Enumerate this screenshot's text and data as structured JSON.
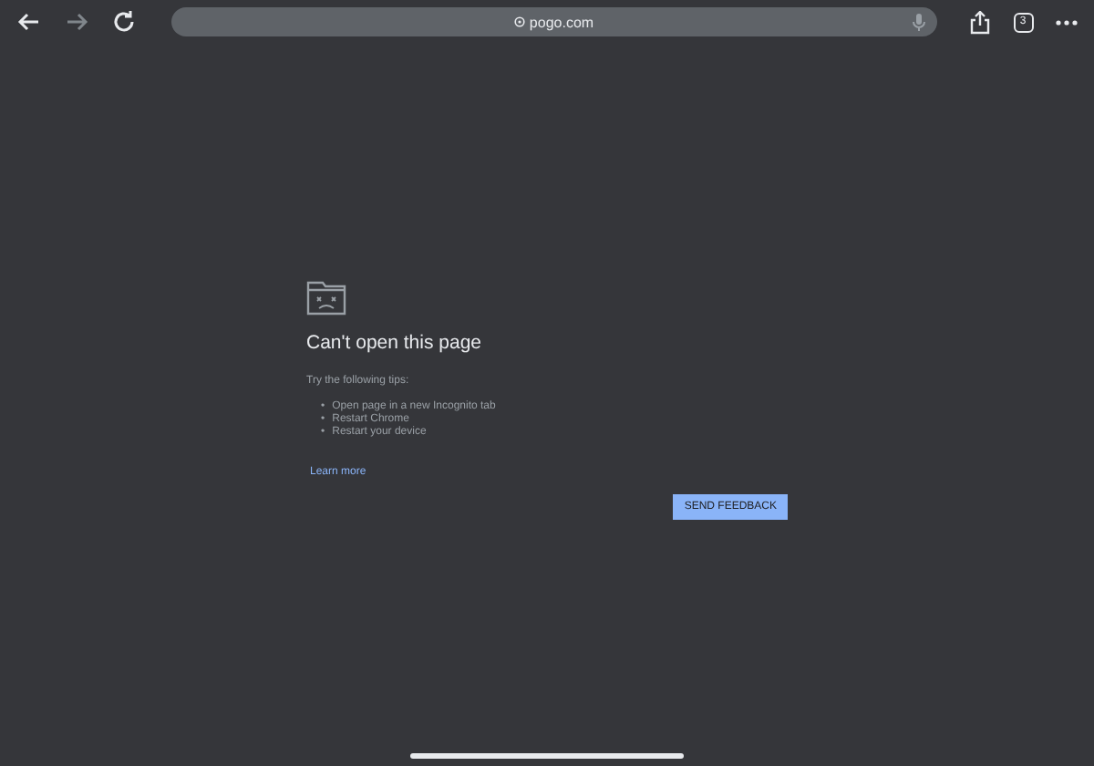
{
  "toolbar": {
    "back": {
      "disabled": false
    },
    "forward": {
      "disabled": true
    },
    "address": "pogo.com",
    "tab_count": "3"
  },
  "error": {
    "title": "Can't open this page",
    "tips_heading": "Try the following tips:",
    "tips": [
      {
        "marker": "•",
        "text": "Open page in a new Incognito tab"
      },
      {
        "marker": "•",
        "text": "Restart Chrome"
      },
      {
        "marker": "•",
        "text": "Restart your device"
      }
    ],
    "link": "Learn more",
    "button": "SEND FEEDBACK"
  }
}
